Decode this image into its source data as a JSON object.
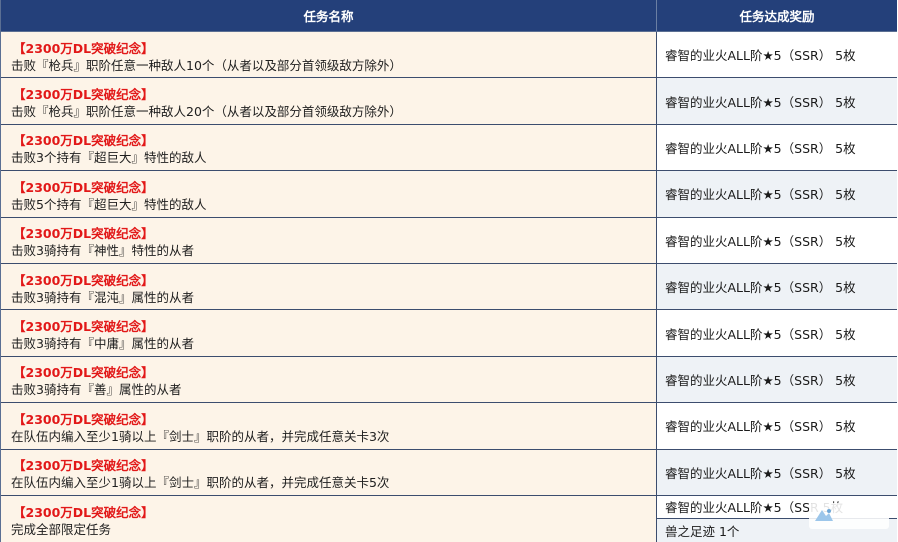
{
  "header": {
    "task_name": "任务名称",
    "reward": "任务达成奖励"
  },
  "rows": [
    {
      "tag": "【2300万DL突破纪念】",
      "desc": "击败『枪兵』职阶任意一种敌人10个（从者以及部分首领级敌方除外）",
      "reward": "睿智的业火ALL阶★5（SSR） 5枚"
    },
    {
      "tag": "【2300万DL突破纪念】",
      "desc": "击败『枪兵』职阶任意一种敌人20个（从者以及部分首领级敌方除外）",
      "reward": "睿智的业火ALL阶★5（SSR） 5枚"
    },
    {
      "tag": "【2300万DL突破纪念】",
      "desc": "击败3个持有『超巨大』特性的敌人",
      "reward": "睿智的业火ALL阶★5（SSR） 5枚"
    },
    {
      "tag": "【2300万DL突破纪念】",
      "desc": "击败5个持有『超巨大』特性的敌人",
      "reward": "睿智的业火ALL阶★5（SSR） 5枚"
    },
    {
      "tag": "【2300万DL突破纪念】",
      "desc": "击败3骑持有『神性』特性的从者",
      "reward": "睿智的业火ALL阶★5（SSR） 5枚"
    },
    {
      "tag": "【2300万DL突破纪念】",
      "desc": "击败3骑持有『混沌』属性的从者",
      "reward": "睿智的业火ALL阶★5（SSR） 5枚"
    },
    {
      "tag": "【2300万DL突破纪念】",
      "desc": "击败3骑持有『中庸』属性的从者",
      "reward": "睿智的业火ALL阶★5（SSR） 5枚"
    },
    {
      "tag": "【2300万DL突破纪念】",
      "desc": "击败3骑持有『善』属性的从者",
      "reward": "睿智的业火ALL阶★5（SSR） 5枚"
    },
    {
      "tag": "【2300万DL突破纪念】",
      "desc": "在队伍内编入至少1骑以上『剑士』职阶的从者，并完成任意关卡3次",
      "reward": "睿智的业火ALL阶★5（SSR） 5枚"
    },
    {
      "tag": "【2300万DL突破纪念】",
      "desc": "在队伍内编入至少1骑以上『剑士』职阶的从者，并完成任意关卡5次",
      "reward": "睿智的业火ALL阶★5（SSR） 5枚"
    }
  ],
  "last_row": {
    "tag": "【2300万DL突破纪念】",
    "desc": "完成全部限定任务",
    "reward_1": "睿智的业火ALL阶★5（SSR 5枚",
    "reward_2": "兽之足迹 1个"
  },
  "colors": {
    "header_bg": "#24407a",
    "tag_red": "#e21818",
    "left_cell_bg": "#fdf4e8",
    "right_cell_alt_bg": "#eef2f6"
  }
}
